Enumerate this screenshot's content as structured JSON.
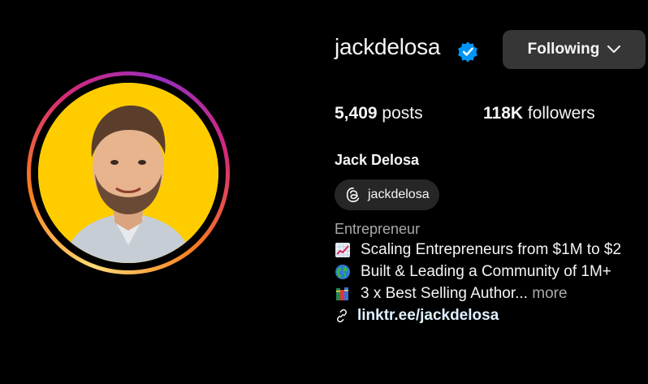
{
  "profile": {
    "username": "jackdelosa",
    "follow_button_label": "Following",
    "posts_count": "5,409",
    "posts_label": " posts",
    "followers_count": "118K",
    "followers_label": " followers",
    "full_name": "Jack Delosa",
    "threads_handle": "jackdelosa",
    "category": "Entrepreneur",
    "bio_lines": [
      {
        "icon": "chart-increasing-emoji-icon",
        "text": "Scaling Entrepreneurs from $1M to $2"
      },
      {
        "icon": "globe-emoji-icon",
        "text": "Built & Leading a Community of 1M+ "
      },
      {
        "icon": "books-emoji-icon",
        "text": "3 x Best Selling Author...",
        "more": " more"
      }
    ],
    "link_text": "linktr.ee/jackdelosa"
  },
  "colors": {
    "background": "#000000",
    "button_bg": "#363636",
    "pill_bg": "#262626",
    "verified_blue": "#0095f6",
    "muted_text": "#a8a8a8",
    "link_text": "#e0f1ff",
    "avatar_bg": "#ffcc00"
  }
}
